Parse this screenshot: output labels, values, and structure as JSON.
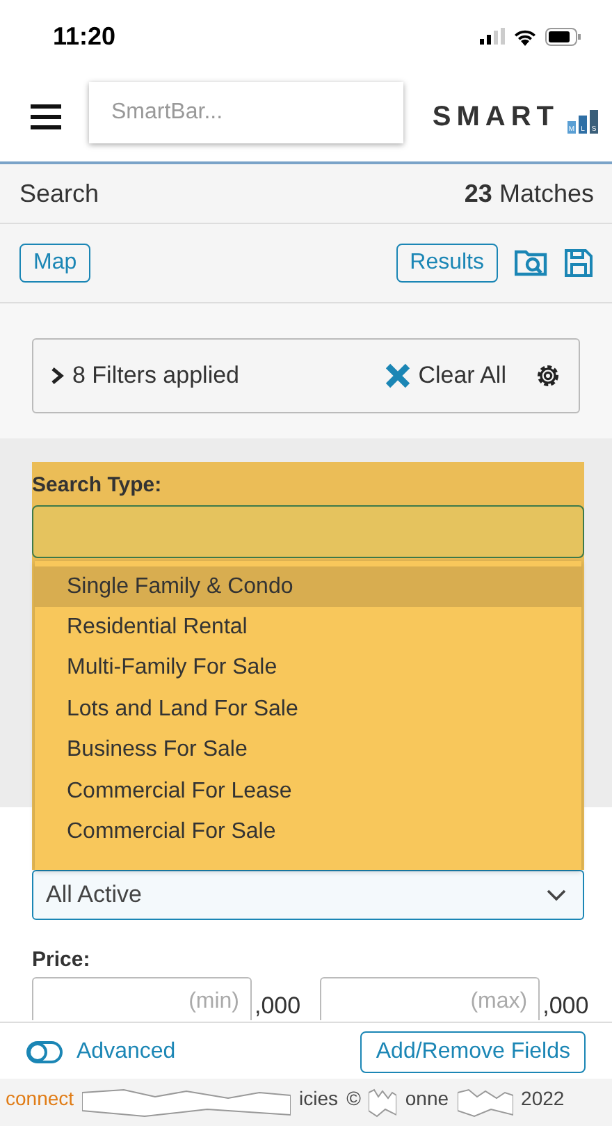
{
  "status_bar": {
    "time": "11:20"
  },
  "header": {
    "search": {
      "placeholder": "SmartBar..."
    },
    "logo": {
      "text": "SMART",
      "bars": [
        "M",
        "L",
        "S"
      ]
    }
  },
  "search_bar": {
    "title": "Search",
    "count": "23",
    "count_label": "Matches"
  },
  "toolbar": {
    "left_buttons": [
      "Map"
    ],
    "right_buttons": [
      "Results"
    ]
  },
  "filters": {
    "expanded": false,
    "summary": "8 Filters applied",
    "clear": "Clear All"
  },
  "search_type": {
    "label": "Search Type:",
    "options": [
      {
        "label": "Single Family & Condo",
        "selected": true
      },
      {
        "label": "Residential Rental",
        "selected": false
      },
      {
        "label": "Multi-Family For Sale",
        "selected": false
      },
      {
        "label": "Lots and Land For Sale",
        "selected": false
      },
      {
        "label": "Business For Sale",
        "selected": false
      },
      {
        "label": "Commercial For Lease",
        "selected": false
      },
      {
        "label": "Commercial For Sale",
        "selected": false
      }
    ]
  },
  "status_select": {
    "value": "All Active"
  },
  "price": {
    "label": "Price:",
    "min_placeholder": "(min)",
    "max_placeholder": "(max)",
    "min_suffix": ",000",
    "max_suffix": ",000"
  },
  "bottom_bar": {
    "advanced": {
      "label": "Advanced",
      "on": false
    },
    "button": "Add/Remove Fields"
  },
  "footer": {
    "fragments": [
      "connect",
      "icies",
      "©",
      "onne",
      "2022"
    ]
  }
}
